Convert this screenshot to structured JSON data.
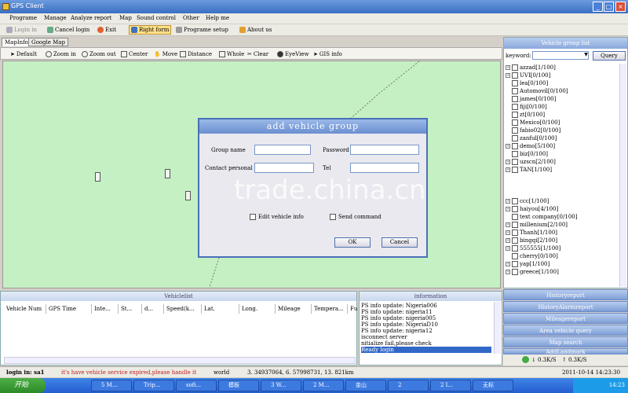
{
  "window": {
    "title": "GPS Client"
  },
  "menu": [
    "Programe",
    "Manage",
    "Analyze report",
    "Map",
    "Sound control",
    "Other",
    "Help me"
  ],
  "toolbar": [
    "Login in",
    "Cancel login",
    "Exit",
    "Right form",
    "Programe setup",
    "About us"
  ],
  "map_tabs": [
    "MapInfo",
    "Google Map"
  ],
  "map_tools": [
    "Default",
    "Zoom in",
    "Zoom out",
    "Center",
    "Move",
    "Distance",
    "Whole",
    "Clear",
    "EyeView",
    "GIS info"
  ],
  "watermark": "trade.china.cn",
  "dialog": {
    "title": "add vehicle group",
    "group_name_label": "Group name",
    "password_label": "Password",
    "contact_label": "Contact personal",
    "tel_label": "Tel",
    "edit_info": "Edit vehicle info",
    "send_command": "Send command",
    "ok": "OK",
    "cancel": "Cancel"
  },
  "right_panel": {
    "title": "Vehicle group list",
    "keyword_label": "keyword:",
    "query": "Query",
    "groups": [
      "azzad[1/100]",
      "UVI[0/100]",
      "lea[0/100]",
      "Automovil[0/100]",
      "james[0/100]",
      "fiji[0/100]",
      "zt[0/100]",
      "Mexico[0/100]",
      "fabio02[0/100]",
      "zanful[0/100]",
      "demo[5/100]",
      "biz[0/100]",
      "uzscn[2/100]",
      "TAN[1/100]",
      "ccc[1/100]",
      "haiyou[4/100]",
      "text company[0/100]",
      "millenium[2/100]",
      "Thanh[1/100]",
      "bingqi[2/100]",
      "555555[1/100]",
      "cherry[0/100]",
      "yap[1/100]",
      "greece[1/100]"
    ],
    "bars": [
      "Historyreport",
      "HistoryAlarmreport",
      "Mileagereport",
      "Area vehicle query",
      "Map search",
      "AddLandmark"
    ],
    "speed_down": "0.3K/S",
    "speed_up": "0.3K/S",
    "datetime": "2011-10-14 14:23:30"
  },
  "vehicle_list": {
    "title": "Vehiclelist",
    "columns": [
      "Vehicle Num",
      "GPS Time",
      "Inte...",
      "St...",
      "d...",
      "Speed(k...",
      "Lat.",
      "Long.",
      "Mileage",
      "Tempera...",
      "Fu"
    ]
  },
  "information": {
    "title": "information",
    "lines": [
      "PS info update: Nigeria006",
      "PS info update: nigeria11",
      "PS info update: nigeria005",
      "PS info update: NigeriaD10",
      "PS info update: nigeria12",
      "isconnect server",
      "nitialize fail,please check",
      "Ready login"
    ]
  },
  "status": {
    "login": "login in: sa1",
    "message": "it's have vehicle service expired,please handle it",
    "world": "world",
    "coords": "3. 34937064, 6. 57998731, 13. 821km"
  },
  "taskbar": {
    "start": "开始",
    "items": [
      "5 M...",
      "Trip...",
      "sofi...",
      "模板",
      "3 W...",
      "2 M...",
      "金山",
      "2",
      "2 I...",
      "无标"
    ],
    "clock": "14:23"
  }
}
